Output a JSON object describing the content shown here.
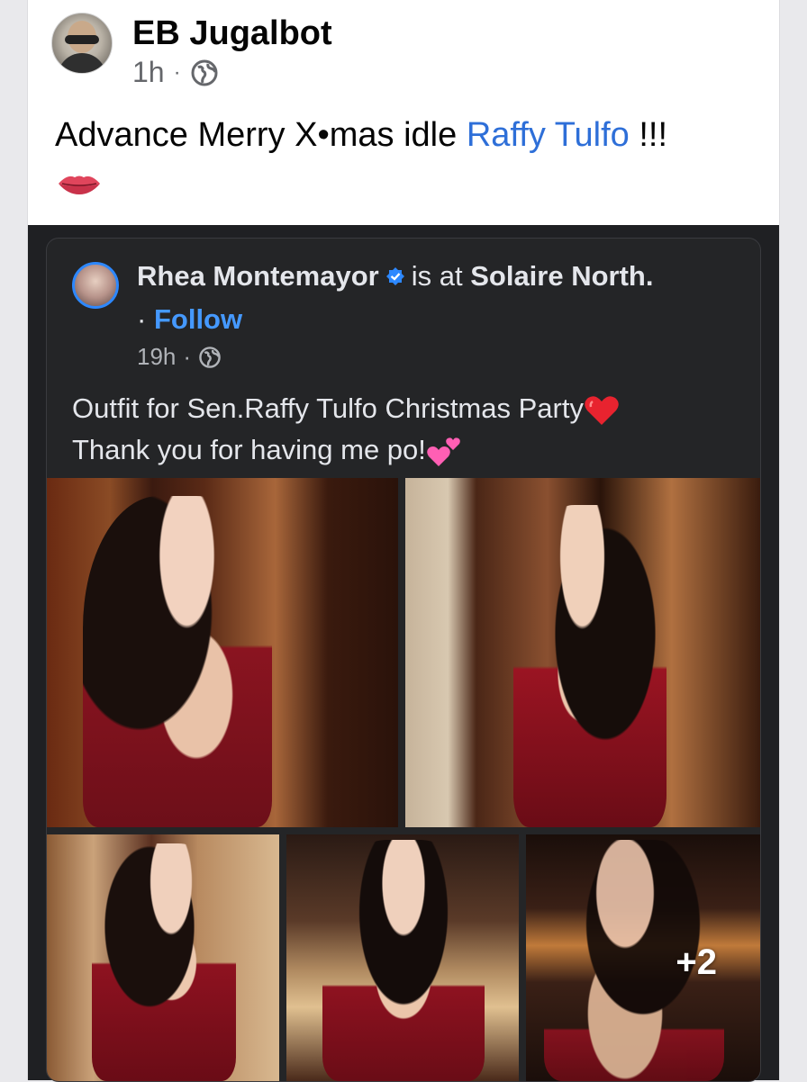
{
  "post": {
    "author": "EB Jugalbot",
    "time": "1h",
    "separator": "·",
    "audience_icon": "globe-icon",
    "text_before": "Advance Merry X•mas idle ",
    "mention": "Raffy Tulfo",
    "text_after": " !!!",
    "emoji": "lips-icon"
  },
  "shared": {
    "author": "Rhea Montemayor",
    "verified_icon": "verified-badge-icon",
    "location_prefix": "is at",
    "location": "Solaire North.",
    "follow_prefix": "·",
    "follow_label": "Follow",
    "time": "19h",
    "separator": "·",
    "audience_icon": "globe-icon",
    "line1": "Outfit for Sen.Raffy Tulfo Christmas Party",
    "line2": "Thank you for having me po!",
    "emoji1": "red-heart-icon",
    "emoji2": "two-hearts-icon",
    "more_photos": "+2"
  },
  "colors": {
    "link": "#2e6fd8",
    "follow": "#4599ff",
    "dark_bg": "#242527"
  }
}
